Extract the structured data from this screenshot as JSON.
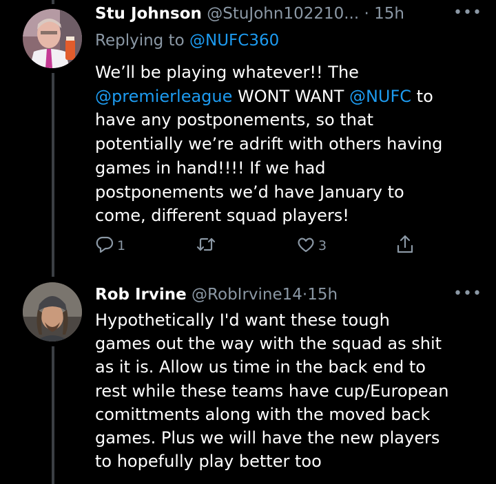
{
  "tweets": [
    {
      "display_name": "Stu Johnson",
      "handle": "@StuJohn102210...",
      "dot": "·",
      "time": "15h",
      "replying_prefix": "Replying to",
      "replying_to": "@NUFC360",
      "text_lines": [
        [
          "We’ll be playing whatever!! The"
        ],
        [
          "@premierleague",
          " WONT WANT ",
          "@NUFC",
          " to"
        ],
        [
          "have any postponements, so that"
        ],
        [
          "potentially we’re adrift with others having"
        ],
        [
          "games in hand!!!! If we had"
        ],
        [
          "postponements we’d have January to"
        ],
        [
          "come, different squad players!"
        ]
      ],
      "reply_count": "1",
      "retweet_count": "",
      "like_count": "3"
    },
    {
      "display_name": "Rob Irvine",
      "handle": "@RobIrvine14",
      "dot": "·",
      "time": "15h",
      "text_lines": [
        "Hypothetically I'd want these tough",
        "games out the way with the squad as shit",
        "as it is. Allow us time in the back end to",
        "rest while these teams have cup/European",
        "comittments along with the moved back",
        "games. Plus we will have the new players",
        "to hopefully play better too"
      ]
    }
  ],
  "colors": {
    "background": "#000000",
    "text": "#ffffff",
    "secondary": "#8b98a5",
    "link": "#1d9bf0",
    "thread_line": "#3b3f44"
  },
  "icons": [
    "more-icon",
    "reply-icon",
    "retweet-icon",
    "like-icon",
    "share-icon"
  ]
}
